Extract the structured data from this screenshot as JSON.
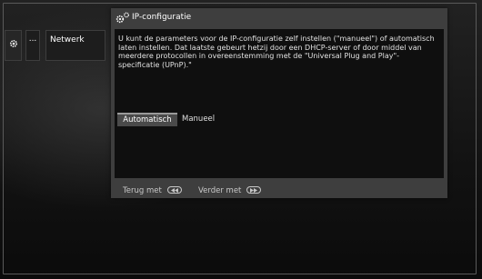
{
  "breadcrumb": {
    "settings_icon": "gear-icon",
    "ellipsis": "...",
    "network_label": "Netwerk"
  },
  "dialog": {
    "icon": "gears-icon",
    "title": "IP-configuratie",
    "description": "U kunt de parameters voor de IP-configuratie zelf instellen (\"manueel\") of automatisch laten instellen. Dat laatste gebeurt hetzij door een DHCP-server of door middel van meerdere protocollen in overeenstemming met de \"Universal Plug and Play\"-specificatie (UPnP).\"",
    "options": [
      {
        "label": "Automatisch",
        "selected": true
      },
      {
        "label": "Manueel",
        "selected": false
      }
    ],
    "footer": {
      "back_label": "Terug met",
      "back_icon": "rewind-button-icon",
      "next_label": "Verder met",
      "next_icon": "fast-forward-button-icon"
    }
  },
  "colors": {
    "dialog_bg": "#3e3e3e",
    "content_bg": "#0f0f0f",
    "selected_option_bg": "#4a4a4a"
  }
}
